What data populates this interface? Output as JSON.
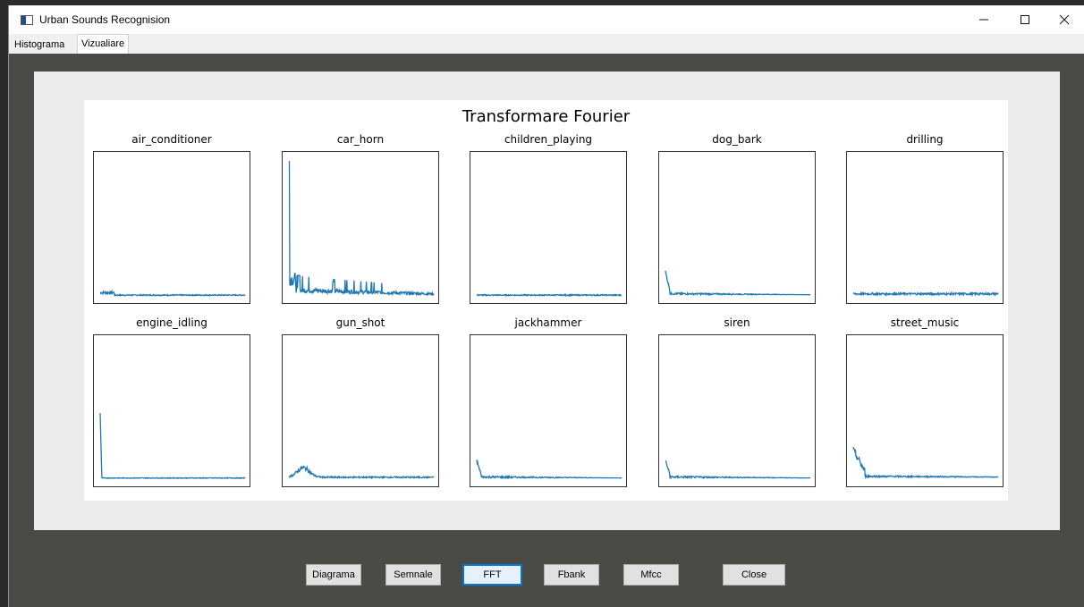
{
  "window": {
    "title": "Urban Sounds Recognision",
    "minimize_icon": "minimize-icon",
    "maximize_icon": "maximize-icon",
    "close_icon": "close-icon"
  },
  "tabs": [
    {
      "label": "Histograma",
      "active": false
    },
    {
      "label": "Vizualiare",
      "active": true
    }
  ],
  "figure": {
    "suptitle": "Transformare Fourier"
  },
  "chart_data": {
    "type": "line",
    "title": "Transformare Fourier",
    "color": "#1f77b4",
    "grid": false,
    "subplots": [
      {
        "title": "air_conditioner",
        "profile": "low-flat",
        "peak": 0.05
      },
      {
        "title": "car_horn",
        "profile": "spiky",
        "peak": 0.97
      },
      {
        "title": "children_playing",
        "profile": "flat",
        "peak": 0.02
      },
      {
        "title": "dog_bark",
        "profile": "early-spike",
        "peak": 0.17
      },
      {
        "title": "drilling",
        "profile": "flat-noisy",
        "peak": 0.03
      },
      {
        "title": "engine_idling",
        "profile": "sharp-early",
        "peak": 0.48
      },
      {
        "title": "gun_shot",
        "profile": "bump",
        "peak": 0.08
      },
      {
        "title": "jackhammer",
        "profile": "early-spike",
        "peak": 0.13
      },
      {
        "title": "siren",
        "profile": "early-spike",
        "peak": 0.13
      },
      {
        "title": "street_music",
        "profile": "early-decay",
        "peak": 0.19
      }
    ]
  },
  "buttons": [
    {
      "label": "Diagrama"
    },
    {
      "label": "Semnale"
    },
    {
      "label": "FFT"
    },
    {
      "label": "Fbank"
    },
    {
      "label": "Mfcc"
    },
    {
      "label": "Close"
    }
  ]
}
